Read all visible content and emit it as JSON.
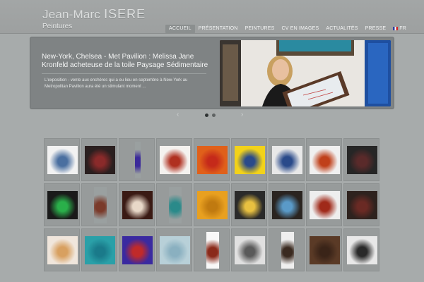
{
  "site": {
    "first_name": "Jean-Marc",
    "last_name": "ISERE",
    "subtitle": "Peintures"
  },
  "nav": {
    "items": [
      {
        "label": "ACCUEIL",
        "active": true
      },
      {
        "label": "PRÉSENTATION",
        "active": false
      },
      {
        "label": "PEINTURES",
        "active": false
      },
      {
        "label": "CV EN IMAGES",
        "active": false
      },
      {
        "label": "ACTUALITÉS",
        "active": false
      },
      {
        "label": "PRESSE",
        "active": false
      }
    ],
    "language": "FR"
  },
  "hero": {
    "title": "New-York, Chelsea - Met Pavilion : Melissa Jane Kronfeld acheteuse de la toile Paysage Sédimentaire",
    "text": "L'exposition - vente aux enchères qui a eu lieu en septembre à New-York au Metropolitan Pavilion aura été un stimulant moment ...",
    "prev_icon": "chevron-left-icon",
    "next_icon": "chevron-right-icon",
    "active_slide": 1,
    "slide_count": 2
  },
  "gallery": {
    "columns": 9,
    "thumbnails": [
      {
        "name": "thumb-white-flags",
        "bg": "#f2f2f2",
        "fg": "#4a6fa0"
      },
      {
        "name": "thumb-dark-red-texture",
        "bg": "#2a1f1f",
        "fg": "#8a2a2a"
      },
      {
        "name": "thumb-purple-stripe",
        "bg": "#9aa0a0",
        "fg": "#3b2a9a"
      },
      {
        "name": "thumb-white-red-landscape",
        "bg": "#f4f2ef",
        "fg": "#b03020"
      },
      {
        "name": "thumb-orange-red-circle",
        "bg": "#e0601a",
        "fg": "#c52a1a"
      },
      {
        "name": "thumb-yellow-poster",
        "bg": "#f2d21a",
        "fg": "#2a4a8a"
      },
      {
        "name": "thumb-gallery-wall",
        "bg": "#e8e8e8",
        "fg": "#2a4a8a"
      },
      {
        "name": "thumb-three-panels",
        "bg": "#f0f0f0",
        "fg": "#c0401a"
      },
      {
        "name": "thumb-dark-circle-texture",
        "bg": "#262626",
        "fg": "#5a2a2a"
      },
      {
        "name": "thumb-rainbow-stripes",
        "bg": "#1a1a1a",
        "fg": "#2ab04a"
      },
      {
        "name": "thumb-tall-white-brown",
        "bg": "#9aa0a0",
        "fg": "#7a3a2a"
      },
      {
        "name": "thumb-red-white-swirl",
        "bg": "#3a1a14",
        "fg": "#e8d8c8"
      },
      {
        "name": "thumb-teal-strip",
        "bg": "#9aa0a0",
        "fg": "#2a8a8a"
      },
      {
        "name": "thumb-yellow-ochre-texture",
        "bg": "#e8a020",
        "fg": "#c07a10"
      },
      {
        "name": "thumb-lit-exhibition",
        "bg": "#2a2a2a",
        "fg": "#e8c040"
      },
      {
        "name": "thumb-round-mirror",
        "bg": "#2a2420",
        "fg": "#5a9ac8"
      },
      {
        "name": "thumb-red-panels-wall",
        "bg": "#eeeeee",
        "fg": "#a02a1a"
      },
      {
        "name": "thumb-dark-brown-circle",
        "bg": "#2e221e",
        "fg": "#6a2a24"
      },
      {
        "name": "thumb-pastel-abstract",
        "bg": "#f0e6dc",
        "fg": "#d8a060"
      },
      {
        "name": "thumb-turquoise-sea",
        "bg": "#2aa0a8",
        "fg": "#1a7a8a"
      },
      {
        "name": "thumb-blue-violet-red",
        "bg": "#3a2aa0",
        "fg": "#c02a2a"
      },
      {
        "name": "thumb-pale-blue-landscape",
        "bg": "#b8d0d8",
        "fg": "#8ab0c0"
      },
      {
        "name": "thumb-catalog-cover",
        "bg": "#f8f8f8",
        "fg": "#8a2a1a"
      },
      {
        "name": "thumb-white-room",
        "bg": "#e0e0e0",
        "fg": "#5a5a5a"
      },
      {
        "name": "thumb-woman-painting",
        "bg": "#efefef",
        "fg": "#3a2a20"
      },
      {
        "name": "thumb-brown-texture",
        "bg": "#5a3a26",
        "fg": "#3a2418"
      },
      {
        "name": "thumb-man-gallery",
        "bg": "#e8e8e8",
        "fg": "#2a2a2a"
      }
    ]
  }
}
